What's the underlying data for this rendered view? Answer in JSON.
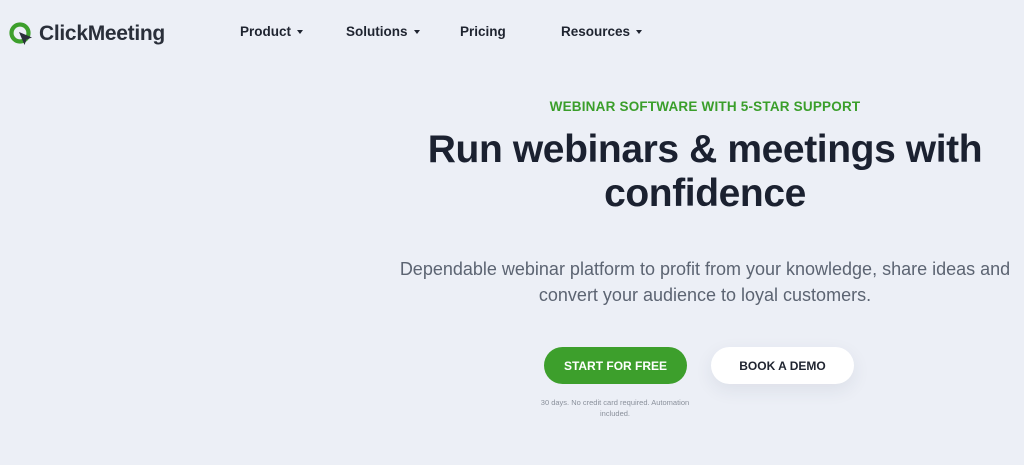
{
  "brand": {
    "name": "ClickMeeting",
    "accent_color": "#3d9f2c",
    "logo_icon": "clickmeeting-logo-icon"
  },
  "nav": {
    "items": [
      {
        "label": "Product",
        "has_dropdown": true
      },
      {
        "label": "Solutions",
        "has_dropdown": true
      },
      {
        "label": "Pricing",
        "has_dropdown": false
      },
      {
        "label": "Resources",
        "has_dropdown": true
      }
    ]
  },
  "hero": {
    "eyebrow": "WEBINAR SOFTWARE WITH 5-STAR SUPPORT",
    "headline": "Run webinars & meetings with confidence",
    "subhead": "Dependable webinar platform to profit from your knowledge, share ideas and convert your audience to loyal customers.",
    "primary_cta": "START FOR FREE",
    "secondary_cta": "BOOK A DEMO",
    "fineprint": "30 days. No credit card required. Automation included."
  },
  "colors": {
    "background": "#eceff6",
    "eyebrow": "#3a9e2a",
    "headline": "#1b2130",
    "subhead": "#5c6472"
  }
}
